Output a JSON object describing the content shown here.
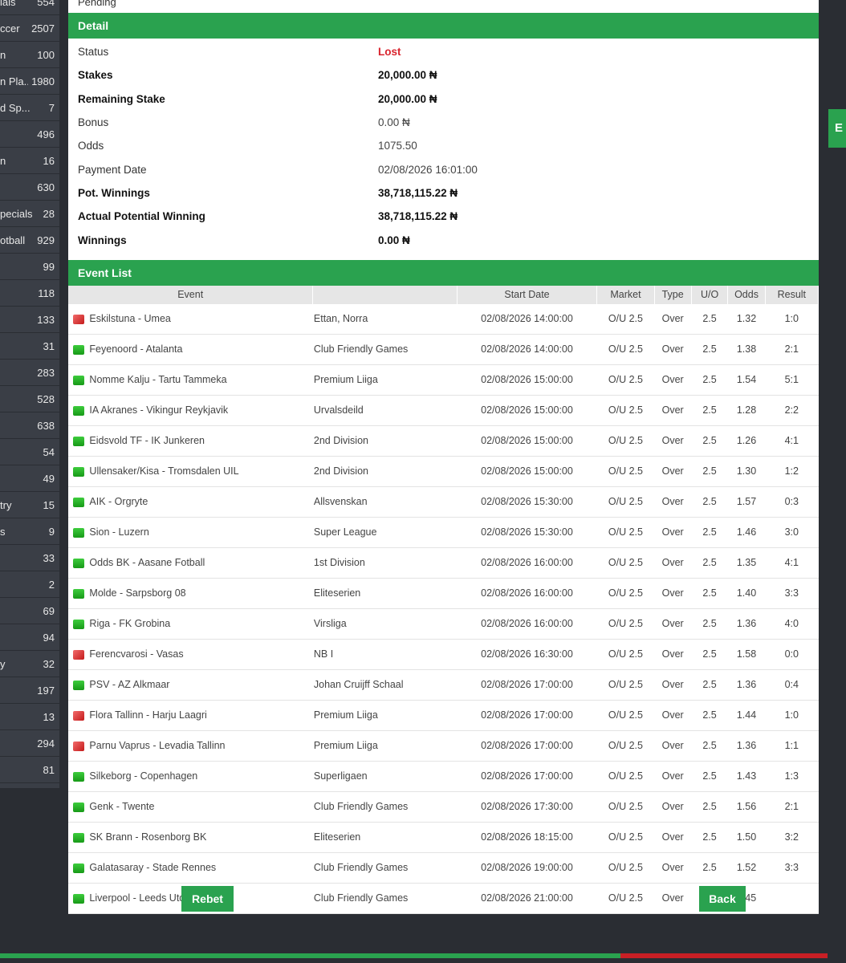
{
  "sidebar": [
    {
      "label": "ials",
      "count": "554"
    },
    {
      "label": "ccer",
      "count": "2507"
    },
    {
      "label": "n",
      "count": "100"
    },
    {
      "label": "n Pla...",
      "count": "1980"
    },
    {
      "label": "d Sp...",
      "count": "7"
    },
    {
      "label": "",
      "count": "496"
    },
    {
      "label": "n",
      "count": "16"
    },
    {
      "label": "",
      "count": "630"
    },
    {
      "label": "pecials",
      "count": "28"
    },
    {
      "label": "otball",
      "count": "929"
    },
    {
      "label": "",
      "count": "99"
    },
    {
      "label": "",
      "count": "118"
    },
    {
      "label": "",
      "count": "133"
    },
    {
      "label": "",
      "count": "31"
    },
    {
      "label": "",
      "count": "283"
    },
    {
      "label": "",
      "count": "528"
    },
    {
      "label": "",
      "count": "638"
    },
    {
      "label": "",
      "count": "54"
    },
    {
      "label": "",
      "count": "49"
    },
    {
      "label": "try",
      "count": "15"
    },
    {
      "label": "s",
      "count": "9"
    },
    {
      "label": "",
      "count": "33"
    },
    {
      "label": "",
      "count": "2"
    },
    {
      "label": "",
      "count": "69"
    },
    {
      "label": "",
      "count": "94"
    },
    {
      "label": "y",
      "count": "32"
    },
    {
      "label": "",
      "count": "197"
    },
    {
      "label": "",
      "count": "13"
    },
    {
      "label": "",
      "count": "294"
    },
    {
      "label": "",
      "count": "81"
    }
  ],
  "pending_label": "Pending",
  "detail": {
    "title": "Detail",
    "rows": [
      {
        "key": "Status",
        "value": "Lost",
        "bold": false,
        "status": true
      },
      {
        "key": "Stakes",
        "value": "20,000.00 ₦",
        "bold": true
      },
      {
        "key": "Remaining Stake",
        "value": "20,000.00 ₦",
        "bold": true
      },
      {
        "key": "Bonus",
        "value": "0.00 ₦",
        "bold": false
      },
      {
        "key": "Odds",
        "value": "1075.50",
        "bold": false
      },
      {
        "key": "Payment Date",
        "value": "02/08/2026 16:01:00",
        "bold": false
      },
      {
        "key": "Pot. Winnings",
        "value": "38,718,115.22 ₦",
        "bold": true
      },
      {
        "key": "Actual Potential Winning",
        "value": "38,718,115.22 ₦",
        "bold": true
      },
      {
        "key": "Winnings",
        "value": "0.00 ₦",
        "bold": true
      }
    ]
  },
  "events": {
    "title": "Event List",
    "headers": {
      "event": "Event",
      "start_date": "Start Date",
      "market": "Market",
      "type": "Type",
      "uo": "U/O",
      "odds": "Odds",
      "result": "Result"
    },
    "rows": [
      {
        "flag": "lost",
        "event": "Eskilstuna - Umea",
        "league": "Ettan, Norra",
        "date": "02/08/2026 14:00:00",
        "market": "O/U 2.5",
        "type": "Over",
        "uo": "2.5",
        "odds": "1.32",
        "result": "1:0"
      },
      {
        "flag": "won",
        "event": "Feyenoord - Atalanta",
        "league": "Club Friendly Games",
        "date": "02/08/2026 14:00:00",
        "market": "O/U 2.5",
        "type": "Over",
        "uo": "2.5",
        "odds": "1.38",
        "result": "2:1"
      },
      {
        "flag": "won",
        "event": "Nomme Kalju - Tartu Tammeka",
        "league": "Premium Liiga",
        "date": "02/08/2026 15:00:00",
        "market": "O/U 2.5",
        "type": "Over",
        "uo": "2.5",
        "odds": "1.54",
        "result": "5:1"
      },
      {
        "flag": "won",
        "event": "IA Akranes - Vikingur Reykjavik",
        "league": "Urvalsdeild",
        "date": "02/08/2026 15:00:00",
        "market": "O/U 2.5",
        "type": "Over",
        "uo": "2.5",
        "odds": "1.28",
        "result": "2:2"
      },
      {
        "flag": "won",
        "event": "Eidsvold TF - IK Junkeren",
        "league": "2nd Division",
        "date": "02/08/2026 15:00:00",
        "market": "O/U 2.5",
        "type": "Over",
        "uo": "2.5",
        "odds": "1.26",
        "result": "4:1"
      },
      {
        "flag": "won",
        "event": "Ullensaker/Kisa - Tromsdalen UIL",
        "league": "2nd Division",
        "date": "02/08/2026 15:00:00",
        "market": "O/U 2.5",
        "type": "Over",
        "uo": "2.5",
        "odds": "1.30",
        "result": "1:2"
      },
      {
        "flag": "won",
        "event": "AIK - Orgryte",
        "league": "Allsvenskan",
        "date": "02/08/2026 15:30:00",
        "market": "O/U 2.5",
        "type": "Over",
        "uo": "2.5",
        "odds": "1.57",
        "result": "0:3"
      },
      {
        "flag": "won",
        "event": "Sion - Luzern",
        "league": "Super League",
        "date": "02/08/2026 15:30:00",
        "market": "O/U 2.5",
        "type": "Over",
        "uo": "2.5",
        "odds": "1.46",
        "result": "3:0"
      },
      {
        "flag": "won",
        "event": "Odds BK - Aasane Fotball",
        "league": "1st Division",
        "date": "02/08/2026 16:00:00",
        "market": "O/U 2.5",
        "type": "Over",
        "uo": "2.5",
        "odds": "1.35",
        "result": "4:1"
      },
      {
        "flag": "won",
        "event": "Molde - Sarpsborg 08",
        "league": "Eliteserien",
        "date": "02/08/2026 16:00:00",
        "market": "O/U 2.5",
        "type": "Over",
        "uo": "2.5",
        "odds": "1.40",
        "result": "3:3"
      },
      {
        "flag": "won",
        "event": "Riga - FK Grobina",
        "league": "Virsliga",
        "date": "02/08/2026 16:00:00",
        "market": "O/U 2.5",
        "type": "Over",
        "uo": "2.5",
        "odds": "1.36",
        "result": "4:0"
      },
      {
        "flag": "lost",
        "event": "Ferencvarosi - Vasas",
        "league": "NB I",
        "date": "02/08/2026 16:30:00",
        "market": "O/U 2.5",
        "type": "Over",
        "uo": "2.5",
        "odds": "1.58",
        "result": "0:0"
      },
      {
        "flag": "won",
        "event": "PSV - AZ Alkmaar",
        "league": "Johan Cruijff Schaal",
        "date": "02/08/2026 17:00:00",
        "market": "O/U 2.5",
        "type": "Over",
        "uo": "2.5",
        "odds": "1.36",
        "result": "0:4"
      },
      {
        "flag": "lost",
        "event": "Flora Tallinn - Harju Laagri",
        "league": "Premium Liiga",
        "date": "02/08/2026 17:00:00",
        "market": "O/U 2.5",
        "type": "Over",
        "uo": "2.5",
        "odds": "1.44",
        "result": "1:0"
      },
      {
        "flag": "lost",
        "event": "Parnu Vaprus - Levadia Tallinn",
        "league": "Premium Liiga",
        "date": "02/08/2026 17:00:00",
        "market": "O/U 2.5",
        "type": "Over",
        "uo": "2.5",
        "odds": "1.36",
        "result": "1:1"
      },
      {
        "flag": "won",
        "event": "Silkeborg - Copenhagen",
        "league": "Superligaen",
        "date": "02/08/2026 17:00:00",
        "market": "O/U 2.5",
        "type": "Over",
        "uo": "2.5",
        "odds": "1.43",
        "result": "1:3"
      },
      {
        "flag": "won",
        "event": "Genk - Twente",
        "league": "Club Friendly Games",
        "date": "02/08/2026 17:30:00",
        "market": "O/U 2.5",
        "type": "Over",
        "uo": "2.5",
        "odds": "1.56",
        "result": "2:1"
      },
      {
        "flag": "won",
        "event": "SK Brann - Rosenborg BK",
        "league": "Eliteserien",
        "date": "02/08/2026 18:15:00",
        "market": "O/U 2.5",
        "type": "Over",
        "uo": "2.5",
        "odds": "1.50",
        "result": "3:2"
      },
      {
        "flag": "won",
        "event": "Galatasaray - Stade Rennes",
        "league": "Club Friendly Games",
        "date": "02/08/2026 19:00:00",
        "market": "O/U 2.5",
        "type": "Over",
        "uo": "2.5",
        "odds": "1.52",
        "result": "3:3"
      },
      {
        "flag": "won",
        "event": "Liverpool - Leeds Utd",
        "league": "Club Friendly Games",
        "date": "02/08/2026 21:00:00",
        "market": "O/U 2.5",
        "type": "Over",
        "uo": "2.5",
        "odds": "1.45",
        "result": ""
      }
    ]
  },
  "buttons": {
    "rebet": "Rebet",
    "back": "Back"
  },
  "right_tab": "E",
  "colors": {
    "accent": "#2aa24f",
    "lost": "#d9232d",
    "sidebar": "#3a3e46",
    "background": "#2a2d33"
  }
}
